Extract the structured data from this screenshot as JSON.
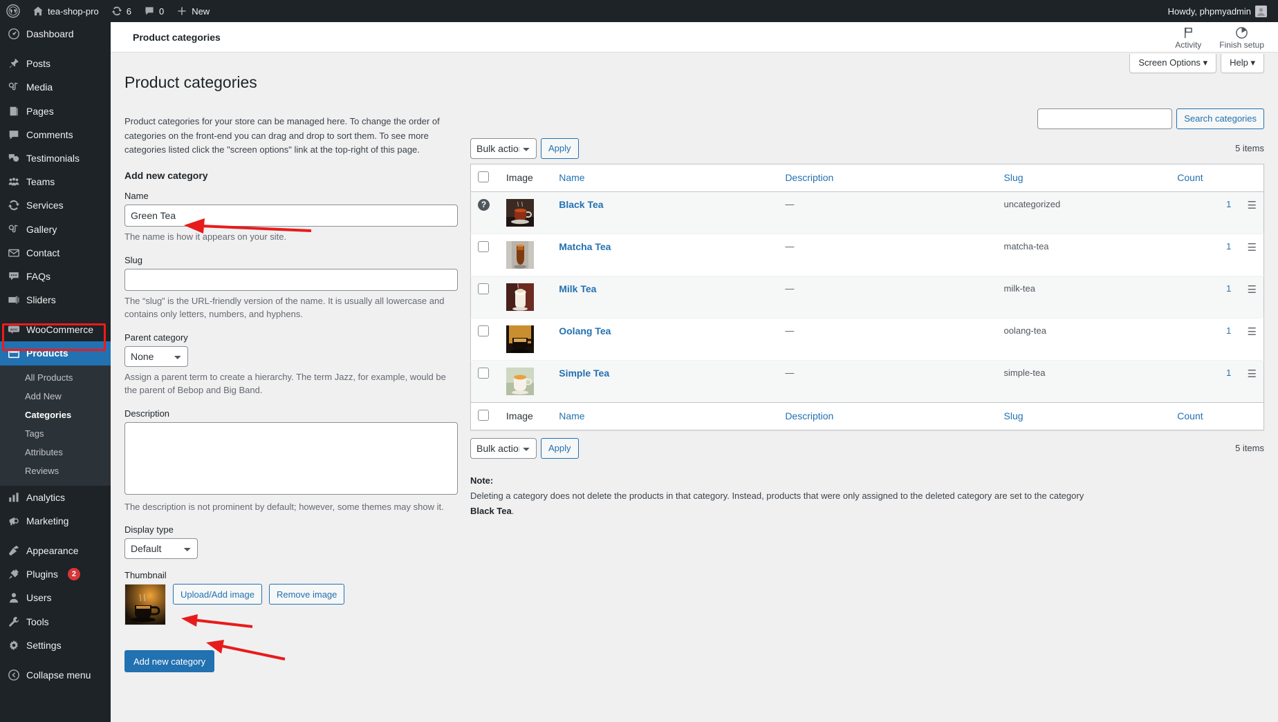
{
  "adminbar": {
    "logo_icon": "wordpress-icon",
    "site_icon": "home-icon",
    "site_name": "tea-shop-pro",
    "updates_icon": "updates-icon",
    "updates_count": "6",
    "comments_icon": "comment-icon",
    "comments_count": "0",
    "new_icon": "plus-icon",
    "new_label": "New",
    "howdy": "Howdy, phpmyadmin"
  },
  "sidebar": {
    "items": [
      {
        "label": "Dashboard",
        "icon": "dashboard-icon"
      },
      {
        "label": "Posts",
        "icon": "pin-icon"
      },
      {
        "label": "Media",
        "icon": "media-icon"
      },
      {
        "label": "Pages",
        "icon": "page-icon"
      },
      {
        "label": "Comments",
        "icon": "comment-icon"
      },
      {
        "label": "Testimonials",
        "icon": "testimonials-icon"
      },
      {
        "label": "Teams",
        "icon": "teams-icon"
      },
      {
        "label": "Services",
        "icon": "services-icon"
      },
      {
        "label": "Gallery",
        "icon": "gallery-icon"
      },
      {
        "label": "Contact",
        "icon": "envelope-icon"
      },
      {
        "label": "FAQs",
        "icon": "faq-icon"
      },
      {
        "label": "Sliders",
        "icon": "sliders-icon"
      },
      {
        "label": "WooCommerce",
        "icon": "woocommerce-icon"
      },
      {
        "label": "Products",
        "icon": "products-icon"
      },
      {
        "label": "Analytics",
        "icon": "analytics-icon"
      },
      {
        "label": "Marketing",
        "icon": "marketing-icon"
      },
      {
        "label": "Appearance",
        "icon": "appearance-icon"
      },
      {
        "label": "Plugins",
        "icon": "plugins-icon",
        "badge": "2"
      },
      {
        "label": "Users",
        "icon": "users-icon"
      },
      {
        "label": "Tools",
        "icon": "tools-icon"
      },
      {
        "label": "Settings",
        "icon": "settings-icon"
      }
    ],
    "products_submenu": [
      {
        "label": "All Products",
        "current": false
      },
      {
        "label": "Add New",
        "current": false
      },
      {
        "label": "Categories",
        "current": true
      },
      {
        "label": "Tags",
        "current": false
      },
      {
        "label": "Attributes",
        "current": false
      },
      {
        "label": "Reviews",
        "current": false
      }
    ],
    "collapse_label": "Collapse menu",
    "collapse_icon": "collapse-icon",
    "highlight_color": "#ef1b1b",
    "current_item_color": "#2271b1"
  },
  "topbar": {
    "breadcrumb": "Product categories",
    "activity_label": "Activity",
    "activity_icon": "flag-icon",
    "finish_setup_label": "Finish setup",
    "finish_setup_icon": "pie-progress-icon",
    "screen_options_label": "Screen Options",
    "help_label": "Help",
    "chevron_icon": "chevron-down-icon"
  },
  "page": {
    "title": "Product categories",
    "intro": "Product categories for your store can be managed here. To change the order of categories on the front-end you can drag and drop to sort them. To see more categories listed click the \"screen options\" link at the top-right of this page."
  },
  "form": {
    "heading": "Add new category",
    "name_label": "Name",
    "name_value": "Green Tea",
    "name_hint": "The name is how it appears on your site.",
    "slug_label": "Slug",
    "slug_value": "",
    "slug_hint": "The “slug” is the URL-friendly version of the name. It is usually all lowercase and contains only letters, numbers, and hyphens.",
    "parent_label": "Parent category",
    "parent_value": "None",
    "parent_options": [
      "None"
    ],
    "parent_hint": "Assign a parent term to create a hierarchy. The term Jazz, for example, would be the parent of Bebop and Big Band.",
    "description_label": "Description",
    "description_value": "",
    "description_hint": "The description is not prominent by default; however, some themes may show it.",
    "display_type_label": "Display type",
    "display_type_value": "Default",
    "display_type_options": [
      "Default"
    ],
    "thumbnail_label": "Thumbnail",
    "thumbnail_icon": "coffee-cup-thumbnail",
    "upload_button": "Upload/Add image",
    "remove_button": "Remove image",
    "submit_button": "Add new category"
  },
  "list": {
    "search_value": "",
    "search_button": "Search categories",
    "bulk_actions_value": "Bulk actions",
    "bulk_actions_options": [
      "Bulk actions"
    ],
    "apply_button": "Apply",
    "items_count_top": "5 items",
    "items_count_bottom": "5 items",
    "columns": [
      "Image",
      "Name",
      "Description",
      "Slug",
      "Count"
    ],
    "rows": [
      {
        "name": "Black Tea",
        "description": "—",
        "slug": "uncategorized",
        "count": "1",
        "locked": true,
        "image_icon": "black-tea-thumbnail"
      },
      {
        "name": "Matcha Tea",
        "description": "—",
        "slug": "matcha-tea",
        "count": "1",
        "locked": false,
        "image_icon": "matcha-tea-thumbnail"
      },
      {
        "name": "Milk Tea",
        "description": "—",
        "slug": "milk-tea",
        "count": "1",
        "locked": false,
        "image_icon": "milk-tea-thumbnail"
      },
      {
        "name": "Oolang Tea",
        "description": "—",
        "slug": "oolang-tea",
        "count": "1",
        "locked": false,
        "image_icon": "oolang-tea-thumbnail"
      },
      {
        "name": "Simple Tea",
        "description": "—",
        "slug": "simple-tea",
        "count": "1",
        "locked": false,
        "image_icon": "simple-tea-thumbnail"
      }
    ],
    "note_label": "Note:",
    "note_text_before": "Deleting a category does not delete the products in that category. Instead, products that were only assigned to the deleted category are set to the category ",
    "note_bold": "Black Tea",
    "note_text_after": "."
  }
}
